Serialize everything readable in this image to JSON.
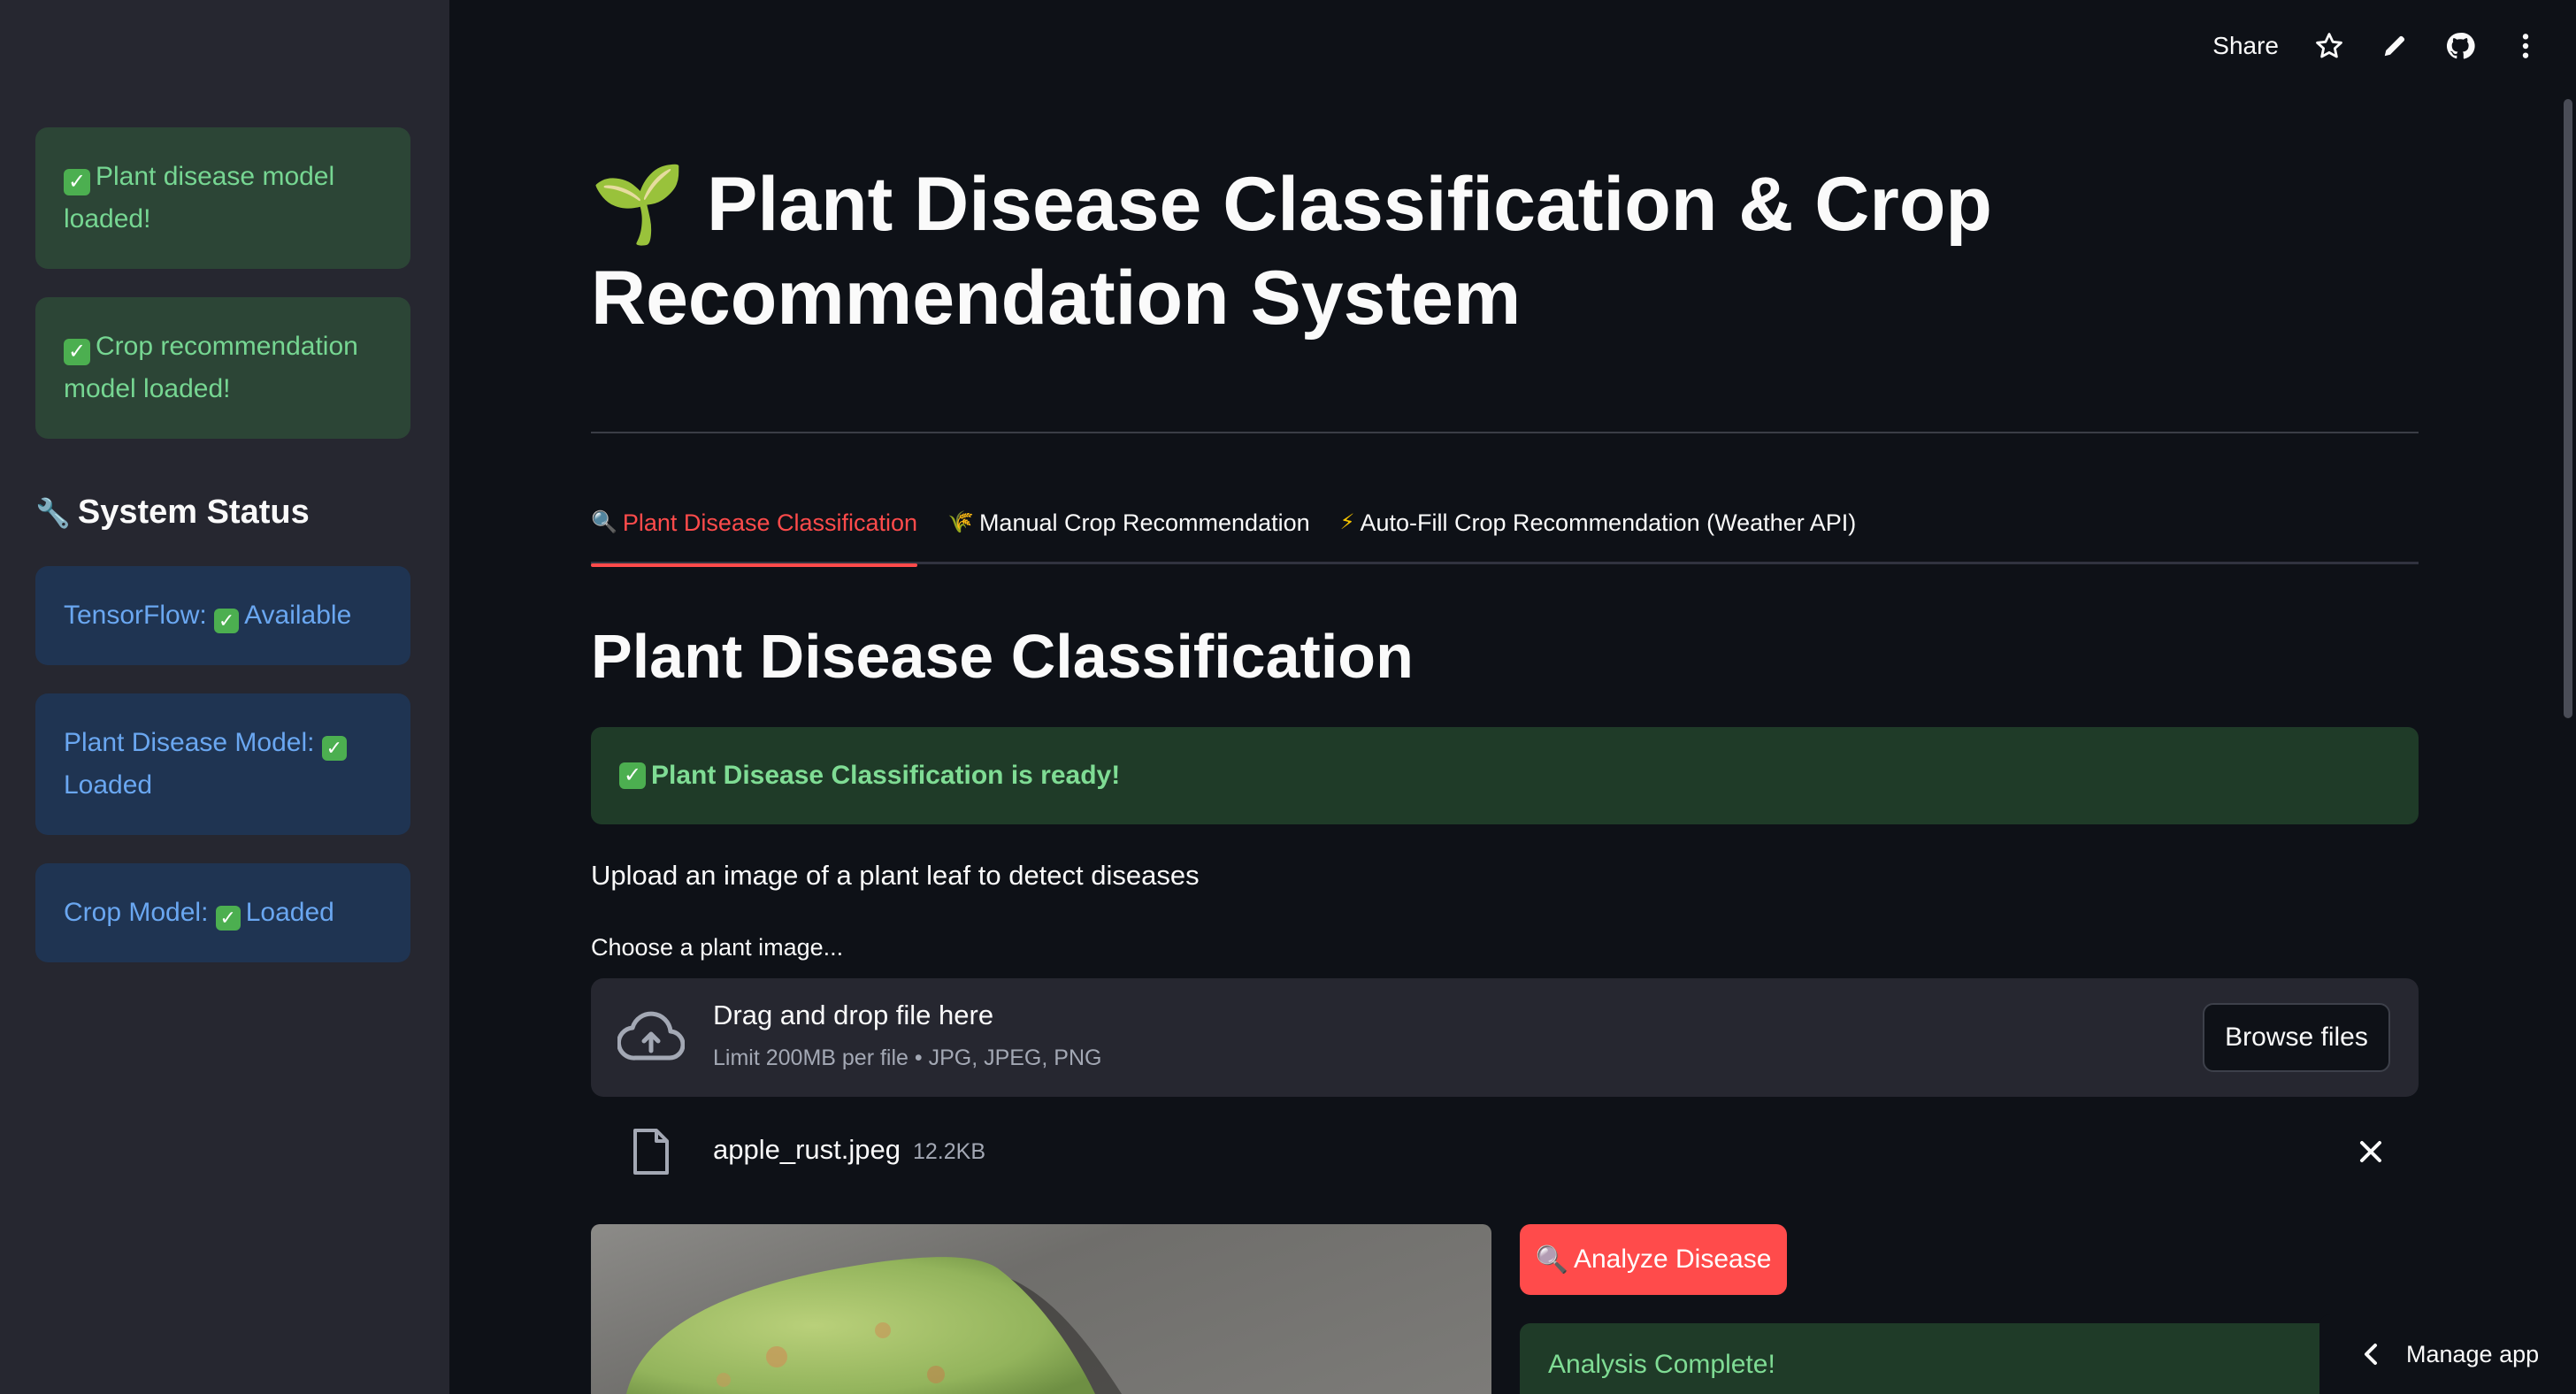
{
  "sidebar": {
    "alerts": [
      {
        "text": "Plant disease model loaded!"
      },
      {
        "text": "Crop recommendation model loaded!"
      }
    ],
    "heading_emoji": "🔧",
    "heading": "System Status",
    "status": [
      {
        "text": "TensorFlow:",
        "value": "Available"
      },
      {
        "text": "Plant Disease Model:",
        "value": "Loaded"
      },
      {
        "text": "Crop Model:",
        "value": "Loaded"
      }
    ]
  },
  "toolbar": {
    "share_label": "Share"
  },
  "main": {
    "title_emoji": "🌱",
    "title": "Plant Disease Classification & Crop Recommendation System",
    "tabs": [
      {
        "emoji": "🔍",
        "label": "Plant Disease Classification",
        "active": true
      },
      {
        "emoji": "🌾",
        "label": "Manual Crop Recommendation",
        "active": false
      },
      {
        "emoji": "⚡",
        "label": "Auto-Fill Crop Recommendation (Weather API)",
        "active": false
      }
    ],
    "section_title": "Plant Disease Classification",
    "ready_banner": "Plant Disease Classification is ready!",
    "upload_description": "Upload an image of a plant leaf to detect diseases",
    "uploader": {
      "label": "Choose a plant image...",
      "drop_title": "Drag and drop file here",
      "drop_hint": "Limit 200MB per file • JPG, JPEG, PNG",
      "browse_label": "Browse files"
    },
    "uploaded_file": {
      "name": "apple_rust.jpeg",
      "size": "12.2KB"
    },
    "analyze_emoji": "🔍",
    "analyze_label": "Analyze Disease",
    "result_banner": "Analysis Complete!"
  },
  "footer": {
    "manage_app_label": "Manage app"
  },
  "colors": {
    "accent": "#ff4b4b",
    "sidebar_bg": "#262730",
    "app_bg": "#0e1117",
    "success_text": "#76d692",
    "info_text": "#6aa7f1"
  }
}
